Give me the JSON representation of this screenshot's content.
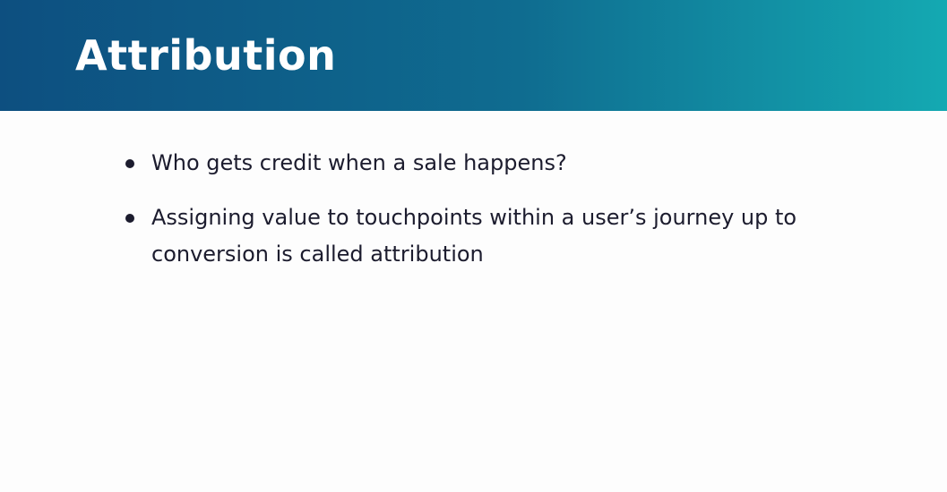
{
  "slide": {
    "title": "Attribution",
    "bullets": [
      "Who gets credit when a sale happens?",
      "Assigning value to touchpoints within a user’s journey up to conversion is called attribution"
    ]
  },
  "colors": {
    "header_gradient_start": "#0d4f80",
    "header_gradient_end": "#14a9b2",
    "title_text": "#ffffff",
    "body_text": "#1c1c2e",
    "background": "#fdfdfd"
  }
}
